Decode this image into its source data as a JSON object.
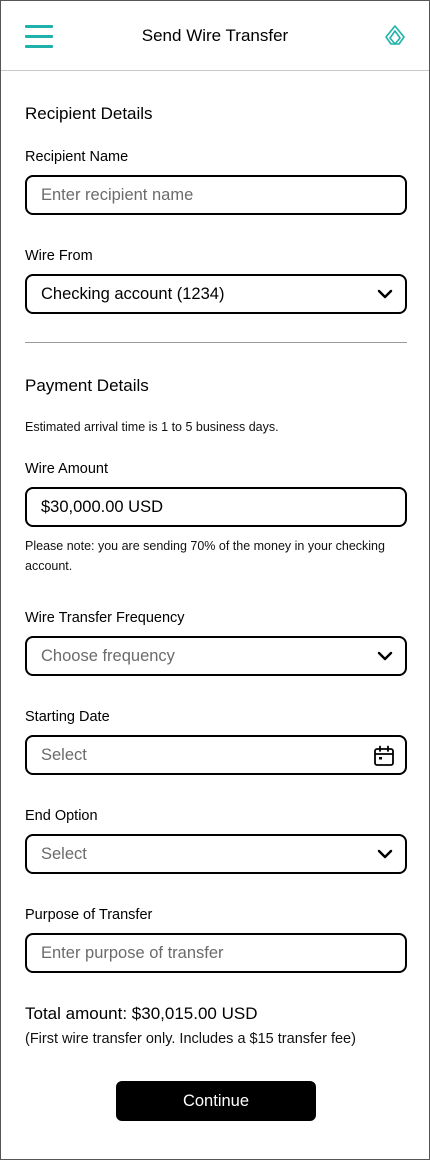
{
  "header": {
    "title": "Send Wire Transfer",
    "menu_icon": "hamburger-menu-icon",
    "logo_icon": "diamond-logo-icon",
    "accent_color": "#20b2aa"
  },
  "recipient_section": {
    "title": "Recipient Details",
    "recipient_name": {
      "label": "Recipient Name",
      "placeholder": "Enter recipient name",
      "value": ""
    },
    "wire_from": {
      "label": "Wire From",
      "value": "Checking account (1234)"
    }
  },
  "payment_section": {
    "title": "Payment Details",
    "arrival_note": "Estimated arrival time is 1 to 5 business days.",
    "wire_amount": {
      "label": "Wire Amount",
      "value": "$30,000.00 USD",
      "note": "Please note: you are sending 70% of the money in your checking account."
    },
    "frequency": {
      "label": "Wire Transfer Frequency",
      "placeholder": "Choose frequency"
    },
    "starting_date": {
      "label": "Starting Date",
      "placeholder": "Select"
    },
    "end_option": {
      "label": "End Option",
      "placeholder": "Select"
    },
    "purpose": {
      "label": "Purpose of Transfer",
      "placeholder": "Enter purpose of transfer"
    }
  },
  "summary": {
    "total": "Total amount: $30,015.00 USD",
    "note": "(First wire transfer only. Includes a $15 transfer fee)"
  },
  "actions": {
    "continue_label": "Continue"
  }
}
